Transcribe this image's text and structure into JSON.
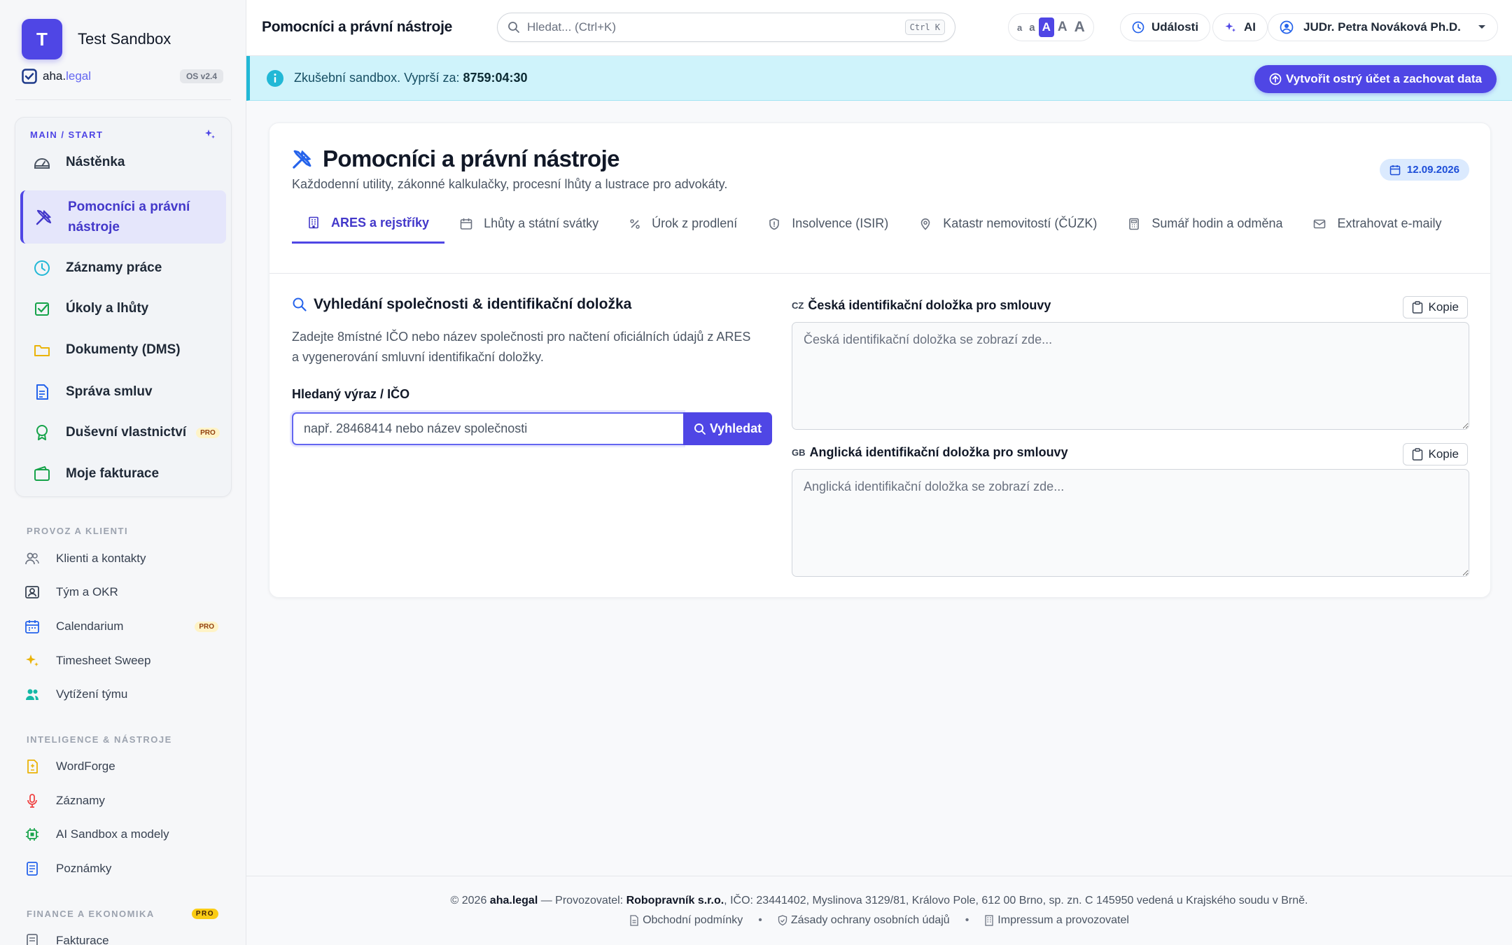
{
  "brand": {
    "initial": "T",
    "name": "Test Sandbox",
    "logo_main": "aha.",
    "logo_accent": "legal",
    "version": "OS v2.4"
  },
  "sidebar": {
    "main_section": "MAIN / START",
    "main_items": [
      {
        "label": "Nástěnka",
        "icon": "dashboard-icon"
      },
      {
        "label": "Pomocníci a právní nástroje",
        "icon": "tools-icon",
        "active": true
      },
      {
        "label": "Záznamy práce",
        "icon": "clock-icon"
      },
      {
        "label": "Úkoly a lhůty",
        "icon": "task-check-icon"
      },
      {
        "label": "Dokumenty (DMS)",
        "icon": "folder-icon"
      },
      {
        "label": "Správa smluv",
        "icon": "contract-icon"
      },
      {
        "label": "Duševní vlastnictví",
        "icon": "award-icon",
        "badge": "PRO"
      },
      {
        "label": "Moje fakturace",
        "icon": "wallet-icon"
      }
    ],
    "section_provoz": "PROVOZ A KLIENTI",
    "provoz_items": [
      {
        "label": "Klienti a kontakty",
        "icon": "users-icon"
      },
      {
        "label": "Tým a OKR",
        "icon": "team-card-icon"
      },
      {
        "label": "Calendarium",
        "icon": "calendar-icon",
        "badge": "PRO"
      },
      {
        "label": "Timesheet Sweep",
        "icon": "sparkle-icon"
      },
      {
        "label": "Vytížení týmu",
        "icon": "workload-icon"
      }
    ],
    "section_intel": "INTELIGENCE & NÁSTROJE",
    "intel_items": [
      {
        "label": "WordForge",
        "icon": "doc-edit-icon"
      },
      {
        "label": "Záznamy",
        "icon": "microphone-icon"
      },
      {
        "label": "AI Sandbox a modely",
        "icon": "chip-icon"
      },
      {
        "label": "Poznámky",
        "icon": "notes-icon"
      }
    ],
    "section_finance": "FINANCE A EKONOMIKA",
    "finance_badge": "PRO",
    "finance_items": [
      {
        "label": "Fakturace",
        "icon": "invoice-icon"
      }
    ]
  },
  "header": {
    "title": "Pomocníci a právní nástroje",
    "search_placeholder": "Hledat... (Ctrl+K)",
    "search_shortcut": "Ctrl K",
    "font_sizes": [
      "a",
      "a",
      "A",
      "A",
      "A"
    ],
    "font_size_active_index": 2,
    "events_label": "Události",
    "ai_label": "AI",
    "user_name": "JUDr. Petra Nováková Ph.D."
  },
  "banner": {
    "text": "Zkušební sandbox. Vyprší za:",
    "countdown": "8759:04:30",
    "cta_label": "Vytvořit ostrý účet a zachovat data"
  },
  "card": {
    "title": "Pomocníci a právní nástroje",
    "subtitle": "Každodenní utility, zákonné kalkulačky, procesní lhůty a lustrace pro advokáty.",
    "date": "12.09.2026",
    "tabs": [
      {
        "label": "ARES a rejstříky",
        "icon": "building-icon",
        "active": true
      },
      {
        "label": "Lhůty a státní svátky",
        "icon": "calendar-icon"
      },
      {
        "label": "Úrok z prodlení",
        "icon": "percent-icon"
      },
      {
        "label": "Insolvence (ISIR)",
        "icon": "shield-icon"
      },
      {
        "label": "Katastr nemovitostí (ČÚZK)",
        "icon": "map-pin-icon"
      },
      {
        "label": "Sumář hodin a odměna",
        "icon": "calculator-icon"
      },
      {
        "label": "Extrahovat e-maily",
        "icon": "mail-icon"
      }
    ],
    "section_title": "Vyhledání společnosti & identifikační doložka",
    "description": "Zadejte 8místné IČO nebo název společnosti pro načtení oficiálních údajů z ARES a vygenerování smluvní identifikační doložky.",
    "field_label": "Hledaný výraz / IČO",
    "field_placeholder": "např. 28468414 nebo název společnosti",
    "search_button": "Vyhledat",
    "cz_flag": "CZ",
    "cz_label": "Česká identifikační doložka pro smlouvy",
    "cz_placeholder": "Česká identifikační doložka se zobrazí zde...",
    "gb_flag": "GB",
    "gb_label": "Anglická identifikační doložka pro smlouvy",
    "gb_placeholder": "Anglická identifikační doložka se zobrazí zde...",
    "copy_label": "Kopie"
  },
  "footer": {
    "prefix": "© 2026",
    "brand": "aha.legal",
    "operator_label": "— Provozovatel:",
    "operator": "Robopravník s.r.o.",
    "details": ", IČO: 23441402, Myslinova 3129/81, Královo Pole, 612 00 Brno, sp. zn. C 145950 vedená u Krajského soudu v Brně.",
    "links": [
      "Obchodní podmínky",
      "Zásady ochrany osobních údajů",
      "Impressum a provozovatel"
    ]
  },
  "colors": {
    "accent": "#4f46e5",
    "banner_bg": "#cff3fb",
    "banner_border": "#22b8d6",
    "pro_badge": "#fef3c7"
  }
}
